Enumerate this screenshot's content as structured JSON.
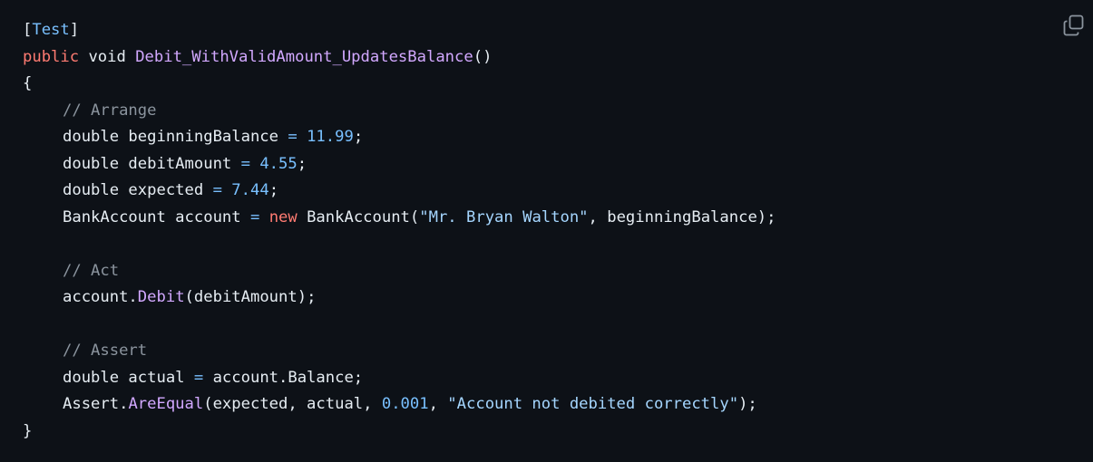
{
  "icons": {
    "copy": "copy-icon"
  },
  "colors": {
    "background": "#0d1117",
    "text": "#e6edf3",
    "keyword": "#ff7b72",
    "function": "#d2a8ff",
    "number": "#79c0ff",
    "string": "#a5d6ff",
    "comment": "#8b949e",
    "icon": "#8b949e"
  },
  "code": {
    "l1": {
      "bo": "[",
      "attr": "Test",
      "bc": "]"
    },
    "l2": {
      "kw": "public",
      "t": " void ",
      "fn": "Debit_WithValidAmount_UpdatesBalance",
      "p": "()"
    },
    "l3": {
      "t": "{"
    },
    "l4": {
      "cm": "// Arrange"
    },
    "l5": {
      "a": "double beginningBalance ",
      "op": "=",
      "sp": " ",
      "num": "11.99",
      "end": ";"
    },
    "l6": {
      "a": "double debitAmount ",
      "op": "=",
      "sp": " ",
      "num": "4.55",
      "end": ";"
    },
    "l7": {
      "a": "double expected ",
      "op": "=",
      "sp": " ",
      "num": "7.44",
      "end": ";"
    },
    "l8": {
      "a": "BankAccount account ",
      "op": "=",
      "sp": " ",
      "kw": "new",
      "b": " BankAccount(",
      "str": "\"Mr. Bryan Walton\"",
      "c": ", beginningBalance);"
    },
    "l10": {
      "cm": "// Act"
    },
    "l11": {
      "a": "account.",
      "fn": "Debit",
      "b": "(debitAmount);"
    },
    "l13": {
      "cm": "// Assert"
    },
    "l14": {
      "a": "double actual ",
      "op": "=",
      "b": " account.Balance;"
    },
    "l15": {
      "a": "Assert.",
      "fn": "AreEqual",
      "b": "(expected, actual, ",
      "num": "0.001",
      "c": ", ",
      "str": "\"Account not debited correctly\"",
      "d": ");"
    },
    "l16": {
      "t": "}"
    }
  }
}
